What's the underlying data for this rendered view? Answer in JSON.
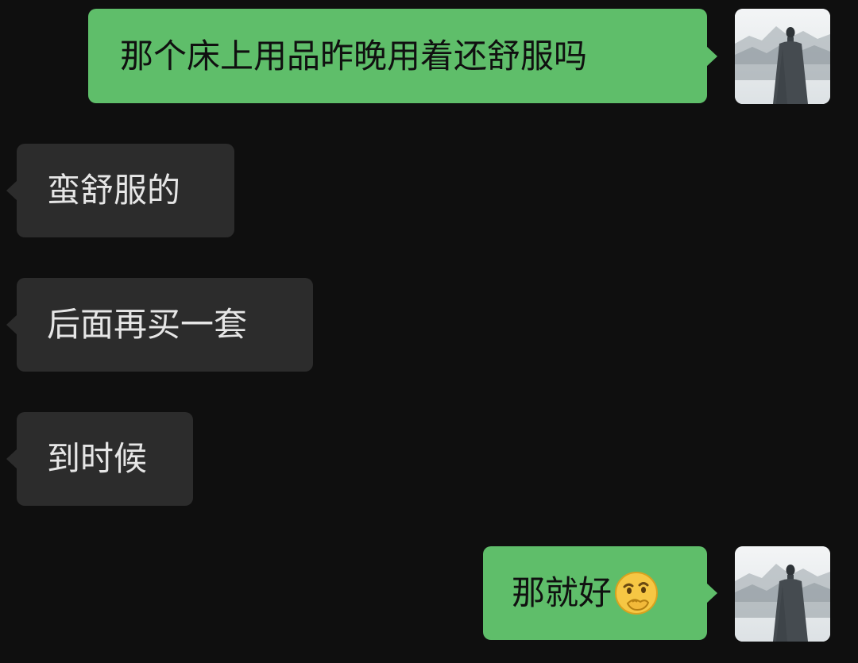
{
  "messages": [
    {
      "side": "out",
      "text": "那个床上用品昨晚用着还舒服吗",
      "avatar": "profile-avatar-landscape-figure"
    },
    {
      "side": "in",
      "text": "蛮舒服的"
    },
    {
      "side": "in",
      "text": "后面再买一套"
    },
    {
      "side": "in",
      "text": "到时候"
    },
    {
      "side": "out",
      "text": "那就好",
      "emoji": "thinking-hand-over-mouth-emoji",
      "avatar": "profile-avatar-landscape-figure"
    }
  ],
  "colors": {
    "background": "#0f0f0f",
    "outgoing_bubble": "#5fbe6a",
    "incoming_bubble": "#2c2c2c",
    "incoming_text": "#e6e6e6",
    "outgoing_text": "#101010"
  }
}
